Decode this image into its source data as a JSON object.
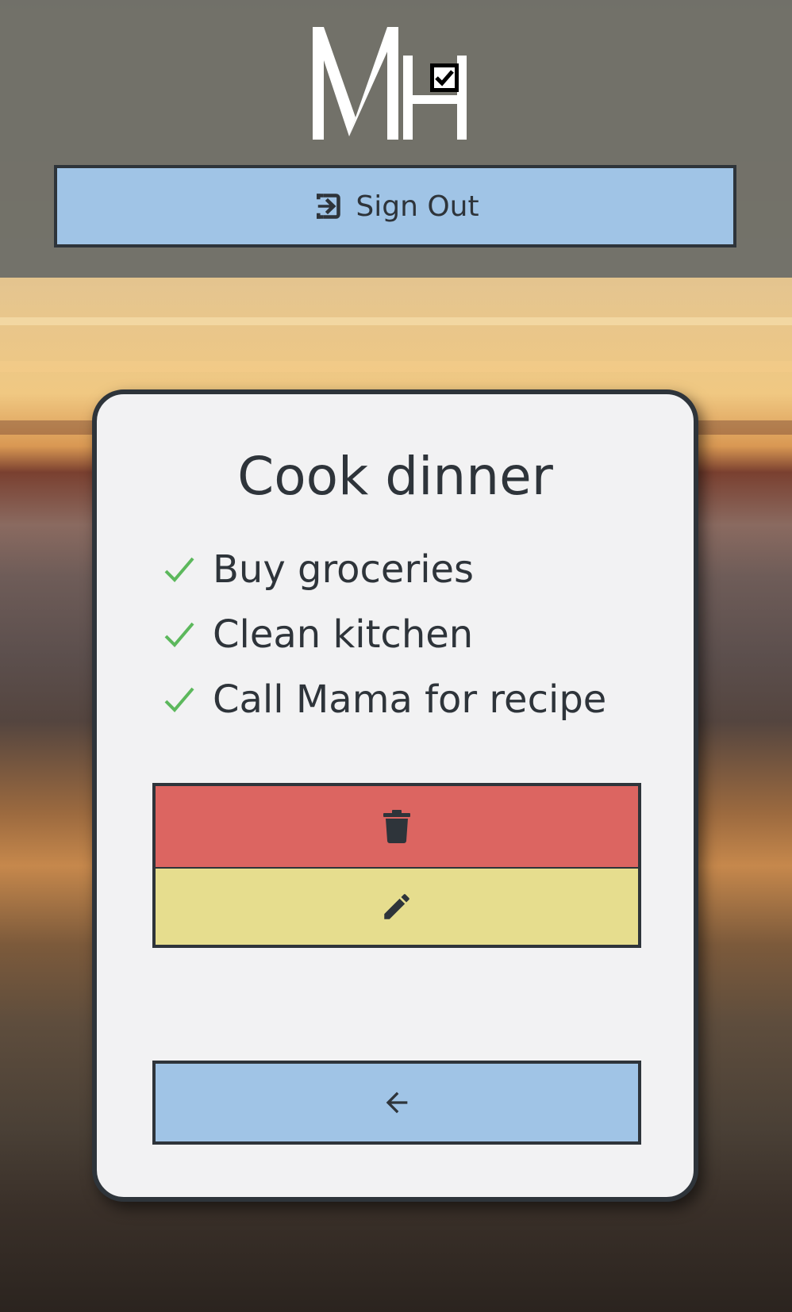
{
  "header": {
    "logo_text": "MH",
    "signout_label": "Sign Out",
    "signout_icon": "sign-out-icon"
  },
  "card": {
    "title": "Cook dinner",
    "tasks": [
      {
        "label": "Buy groceries",
        "done": true
      },
      {
        "label": "Clean kitchen",
        "done": true
      },
      {
        "label": "Call Mama for recipe",
        "done": true
      }
    ],
    "buttons": {
      "delete_icon": "trash-icon",
      "edit_icon": "pencil-icon",
      "back_icon": "arrow-left-icon"
    }
  },
  "colors": {
    "header_bg": "#6e6e68",
    "blue_button": "#a0c4e6",
    "delete_button": "#dc6561",
    "edit_button": "#e6dd8e",
    "card_bg": "#f2f2f3",
    "text_dark": "#2e343a",
    "check_green": "#5cb85c"
  }
}
